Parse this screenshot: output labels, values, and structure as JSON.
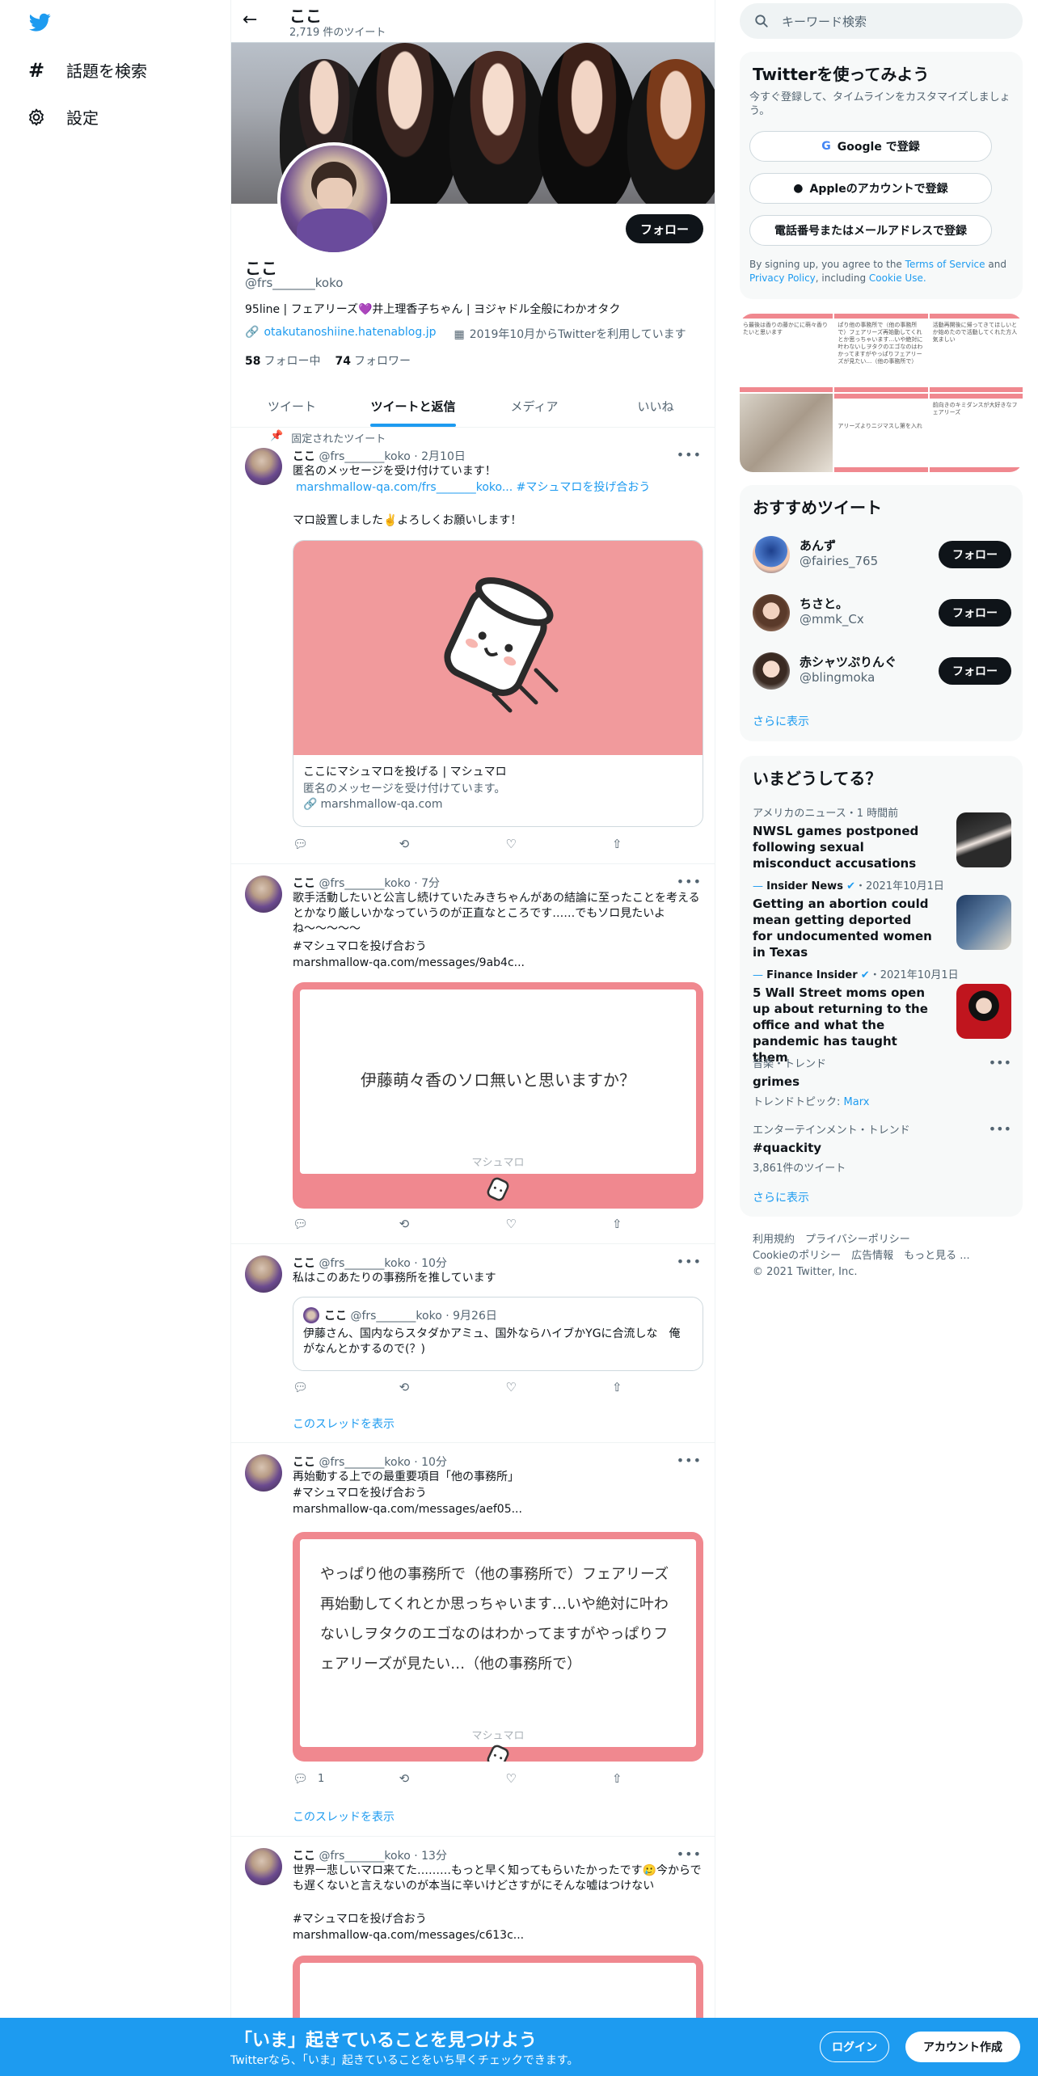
{
  "nav": {
    "logo": "twitter-bird-icon",
    "items": [
      {
        "label": "話題を検索",
        "icon": "hashtag-icon"
      },
      {
        "label": "設定",
        "icon": "gear-icon"
      }
    ]
  },
  "header": {
    "name": "ここ",
    "tweet_count": "2,719 件のツイート"
  },
  "profile": {
    "follow_label": "フォロー",
    "name": "ここ",
    "handle": "@frs_______koko",
    "bio": "95line | フェアリーズ💜井上理香子ちゃん | ヨジャドル全般にわかオタク",
    "website": "otakutanoshiine.hatenablog.jp",
    "joined": "2019年10月からTwitterを利用しています",
    "following_count": "58",
    "following_label": "フォロー中",
    "followers_count": "74",
    "followers_label": "フォロワー"
  },
  "tabs": [
    "ツイート",
    "ツイートと返信",
    "メディア",
    "いいね"
  ],
  "tweets": [
    {
      "pinned_label": "固定されたツイート",
      "name": "ここ",
      "handle": "@frs_______koko",
      "time": "· 2月10日",
      "text1": "匿名のメッセージを受け付けています！",
      "link1": "marshmallow-qa.com/frs_______koko...",
      "hashtag": "#マシュマロを投げ合おう",
      "text2": "マロ設置しました✌️よろしくお願いします！",
      "card_title": "ここにマシュマロを投げる | マシュマロ",
      "card_desc": "匿名のメッセージを受け付けています。",
      "card_link": "marshmallow-qa.com"
    },
    {
      "name": "ここ",
      "handle": "@frs_______koko",
      "time": "· 7分",
      "text": "歌手活動したいと公言し続けていたみきちゃんがあの結論に至ったことを考えるとかなり厳しいかなっていうのが正直なところです……でもソロ見たいよね〜〜〜〜〜",
      "hashtag": "#マシュマロを投げ合おう",
      "link": "marshmallow-qa.com/messages/9ab4c...",
      "marsh_text": "伊藤萌々香のソロ無いと思いますか？",
      "marsh_label": "マシュマロ"
    },
    {
      "name": "ここ",
      "handle": "@frs_______koko",
      "time": "· 10分",
      "text": "私はこのあたりの事務所を推しています",
      "quote_name": "ここ",
      "quote_handle": "@frs_______koko",
      "quote_time": "· 9月26日",
      "quote_text": "伊藤さん、国内ならスタダかアミュ、国外ならハイブかYGに合流しな　俺がなんとかするので(？)",
      "thread_label": "このスレッドを表示"
    },
    {
      "name": "ここ",
      "handle": "@frs_______koko",
      "time": "· 10分",
      "text": "再始動する上での最重要項目「他の事務所」",
      "hashtag": "#マシュマロを投げ合おう",
      "link": "marshmallow-qa.com/messages/aef05...",
      "marsh_text": "やっぱり他の事務所で（他の事務所で）フェアリーズ再始動してくれとか思っちゃいます…いや絶対に叶わないしヲタクのエゴなのはわかってますがやっぱりフェアリーズが見たい…（他の事務所で）",
      "marsh_label": "マシュマロ",
      "reply_count": "1",
      "thread_label": "このスレッドを表示"
    },
    {
      "name": "ここ",
      "handle": "@frs_______koko",
      "time": "· 13分",
      "text": "世界一悲しいマロ来てた………もっと早く知ってもらいたかったです🥲今からでも遅くないと言えないのが本当に辛いけどさすがにそんな嘘はつけない",
      "hashtag": "#マシュマロを投げ合おう",
      "link": "marshmallow-qa.com/messages/c613c..."
    }
  ],
  "right": {
    "search_placeholder": "キーワード検索",
    "signup": {
      "title": "Twitterを使ってみよう",
      "subtitle": "今すぐ登録して、タイムラインをカスタマイズしましょう。",
      "google": "Google で登録",
      "apple": "Appleのアカウントで登録",
      "phone": "電話番号またはメールアドレスで登録",
      "terms_prefix": "By signing up, you agree to the",
      "terms": "Terms of Service",
      "and": "and",
      "privacy": "Privacy Policy",
      "including": ", including",
      "cookie": "Cookie Use."
    },
    "media_texts": [
      "ら最後は香りの藤かにに萌々香りたいと思います",
      "ぱり他の事務所で（他の事務所で）フェアリーズ再始動してくれとか思っちゃいます…いや絶対に叶わないしヲタクのエゴなのはわかってますがやっぱりフェアリーズが見たい…（他の事務所で）",
      "活動再開後に帰ってきてほしいとか始めたので活動してくれた方人気ましい",
      "",
      "アリーズよりニジマスし第を入れ",
      "前向きのキミダンスが大好きなフェアリーズ"
    ],
    "recommend": {
      "title": "おすすめツイート",
      "users": [
        {
          "name": "あんず",
          "handle": "@fairies_765",
          "follow": "フォロー"
        },
        {
          "name": "ちさと。",
          "handle": "@mmk_Cx",
          "follow": "フォロー"
        },
        {
          "name": "赤シャツぷりんぐ",
          "handle": "@blingmoka",
          "follow": "フォロー"
        }
      ],
      "more": "さらに表示"
    },
    "trends": {
      "title": "いまどうしてる？",
      "items": [
        {
          "meta": "アメリカのニュース・1 時間前",
          "title": "NWSL games postponed following sexual misconduct accusations"
        },
        {
          "meta_source": "Insider News",
          "meta_date": "・2021年10月1日",
          "title": "Getting an abortion could mean getting deported for undocumented women in Texas"
        },
        {
          "meta_source": "Finance Insider",
          "meta_date": "・2021年10月1日",
          "title": "5 Wall Street moms open up about returning to the office and what the pandemic has taught them"
        },
        {
          "meta": "音楽・トレンド",
          "title": "grimes",
          "sub_prefix": "トレンドトピック: ",
          "sub_link": "Marx"
        },
        {
          "meta": "エンターテインメント・トレンド",
          "title": "#quackity",
          "sub": "3,861件のツイート"
        }
      ],
      "more": "さらに表示"
    },
    "footer": {
      "line1": "利用規約　プライバシーポリシー",
      "line2": "Cookieのポリシー　広告情報　もっと見る ...",
      "line3": "© 2021 Twitter, Inc."
    }
  },
  "bottombar": {
    "headline": "「いま」起きていることを見つけよう",
    "sub": "Twitterなら、「いま」起きていることをいち早くチェックできます。",
    "login": "ログイン",
    "signup": "アカウント作成"
  },
  "colors": {
    "accent": "#1d9bf0",
    "marshmallow": "#f0888f",
    "text": "#0f1419",
    "muted": "#536471"
  }
}
